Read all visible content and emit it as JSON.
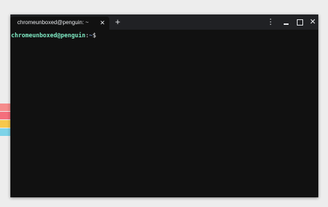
{
  "tab": {
    "title": "chromeunboxed@penguin: ~",
    "close_glyph": "✕",
    "new_tab_glyph": "+"
  },
  "window_controls": {
    "menu_glyph": "⋮",
    "close_glyph": "✕"
  },
  "terminal": {
    "user_host": "chromeunboxed@penguin",
    "separator": ":",
    "path": "~",
    "symbol": "$"
  },
  "colors": {
    "strip_1": "#f58c8c",
    "strip_2": "#f46e7c",
    "strip_3": "#f6c84c",
    "strip_4": "#7dd3e8",
    "terminal_bg": "#111111",
    "titlebar_bg": "#202124",
    "prompt_user": "#7ee8c2",
    "prompt_path": "#8ab4f8"
  }
}
